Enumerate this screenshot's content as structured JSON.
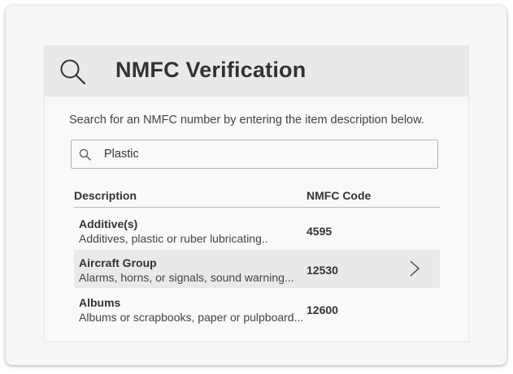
{
  "header": {
    "title": "NMFC Verification"
  },
  "instruction": "Search for an NMFC number by entering the item description below.",
  "search": {
    "value": "Plastic"
  },
  "table": {
    "columns": [
      "Description",
      "NMFC Code"
    ],
    "rows": [
      {
        "title": "Additive(s)",
        "description": "Additives, plastic or ruber lubricating..",
        "code": "4595",
        "selected": false
      },
      {
        "title": "Aircraft Group",
        "description": "Alarms, horns, or signals, sound warning...",
        "code": "12530",
        "selected": true
      },
      {
        "title": "Albums",
        "description": "Albums or scrapbooks, paper or pulpboard...",
        "code": "12600",
        "selected": false
      }
    ]
  },
  "icons": {
    "header": "search-icon",
    "search_field": "search-icon",
    "row_action": "chevron-right-icon"
  },
  "colors": {
    "header_bg": "#e8e9ea",
    "selected_row_bg": "#e8e9ea",
    "text": "#333333"
  }
}
